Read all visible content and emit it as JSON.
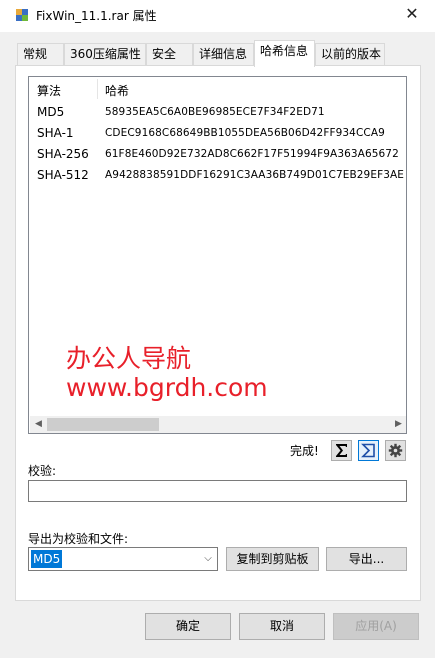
{
  "window": {
    "title": "FixWin_11.1.rar 属性",
    "close_glyph": "✕"
  },
  "tabs": [
    {
      "label": "常规"
    },
    {
      "label": "360压缩属性"
    },
    {
      "label": "安全"
    },
    {
      "label": "详细信息"
    },
    {
      "label": "哈希信息"
    },
    {
      "label": "以前的版本"
    }
  ],
  "active_tab": "哈希信息",
  "hash_list": {
    "columns": [
      "算法",
      "哈希"
    ],
    "rows": [
      {
        "algorithm": "MD5",
        "hash": "58935EA5C6A0BE96985ECE7F34F2ED71"
      },
      {
        "algorithm": "SHA-1",
        "hash": "CDEC9168C68649BB1055DEA56B06D42FF934CCA9"
      },
      {
        "algorithm": "SHA-256",
        "hash": "61F8E460D92E732AD8C662F17F51994F9A363A65672"
      },
      {
        "algorithm": "SHA-512",
        "hash": "A9428838591DDF16291C3AA36B749D01C7EB29EF3AE"
      }
    ]
  },
  "watermark": {
    "line1": "办公人导航",
    "line2": "www.bgrdh.com",
    "color": "#e8202a"
  },
  "status": {
    "done_label": "完成!"
  },
  "toolbar_icons": [
    "sigma-icon",
    "sigma-compare-icon",
    "gear-icon"
  ],
  "verify": {
    "label": "校验:",
    "value": ""
  },
  "export": {
    "label": "导出为校验和文件:",
    "selected": "MD5",
    "copy_button": "复制到剪贴板",
    "export_button": "导出..."
  },
  "footer": {
    "ok": "确定",
    "cancel": "取消",
    "apply": "应用(A)"
  },
  "colors": {
    "selection": "#0078d7",
    "dialog_bg": "#f0f0f0"
  }
}
